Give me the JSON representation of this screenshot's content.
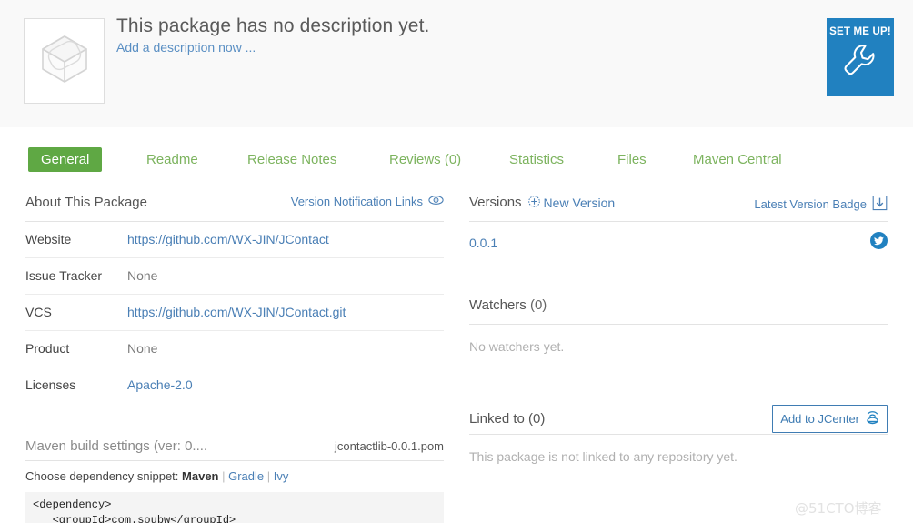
{
  "header": {
    "package_icon": "package-cube-icon",
    "description_title": "This package has no description yet.",
    "add_description_link": "Add a description now ...",
    "setmeup_label": "SET ME UP!",
    "setmeup_icon": "wrench-icon",
    "setmeup_color": "#2181c0"
  },
  "tabs": [
    {
      "label": "General",
      "active": true
    },
    {
      "label": "Readme",
      "active": false
    },
    {
      "label": "Release Notes",
      "active": false
    },
    {
      "label": "Reviews (0)",
      "active": false
    },
    {
      "label": "Statistics",
      "active": false
    },
    {
      "label": "Files",
      "active": false
    },
    {
      "label": "Maven Central",
      "active": false
    }
  ],
  "colors": {
    "tab_active_bg": "#5fa844",
    "tab_text": "#7cb35e",
    "link": "#4a7fb5",
    "accent_blue": "#2181c0"
  },
  "about": {
    "title": "About This Package",
    "action_label": "Version Notification Links",
    "action_icon": "eye-icon",
    "rows": [
      {
        "key": "Website",
        "value": "https://github.com/WX-JIN/JContact",
        "is_link": true
      },
      {
        "key": "Issue Tracker",
        "value": "None",
        "is_link": false
      },
      {
        "key": "VCS",
        "value": "https://github.com/WX-JIN/JContact.git",
        "is_link": true
      },
      {
        "key": "Product",
        "value": "None",
        "is_link": false
      },
      {
        "key": "Licenses",
        "value": "Apache-2.0",
        "is_link": true
      }
    ]
  },
  "maven": {
    "title": "Maven build settings (ver: 0....",
    "pom_file": "jcontactlib-0.0.1.pom",
    "snippet_prefix": "Choose dependency snippet:",
    "snippet_options": [
      {
        "label": "Maven",
        "selected": true
      },
      {
        "label": "Gradle",
        "selected": false
      },
      {
        "label": "Ivy",
        "selected": false
      }
    ],
    "code": "<dependency>\n   <groupId>com.soubw</groupId>"
  },
  "versions": {
    "title": "Versions",
    "new_version_label": "New Version",
    "new_version_icon": "plus-circle-icon",
    "badge_label": "Latest Version Badge",
    "badge_icon": "download-tray-icon",
    "items": [
      {
        "name": "0.0.1",
        "share_icon": "twitter-icon"
      }
    ]
  },
  "watchers": {
    "title": "Watchers",
    "count": "(0)",
    "empty_text": "No watchers yet."
  },
  "linked": {
    "title": "Linked to (0)",
    "button_label": "Add to JCenter",
    "button_icon": "broadcast-icon",
    "empty_text": "This package is not linked to any repository yet."
  },
  "watermark": "@51CTO博客"
}
